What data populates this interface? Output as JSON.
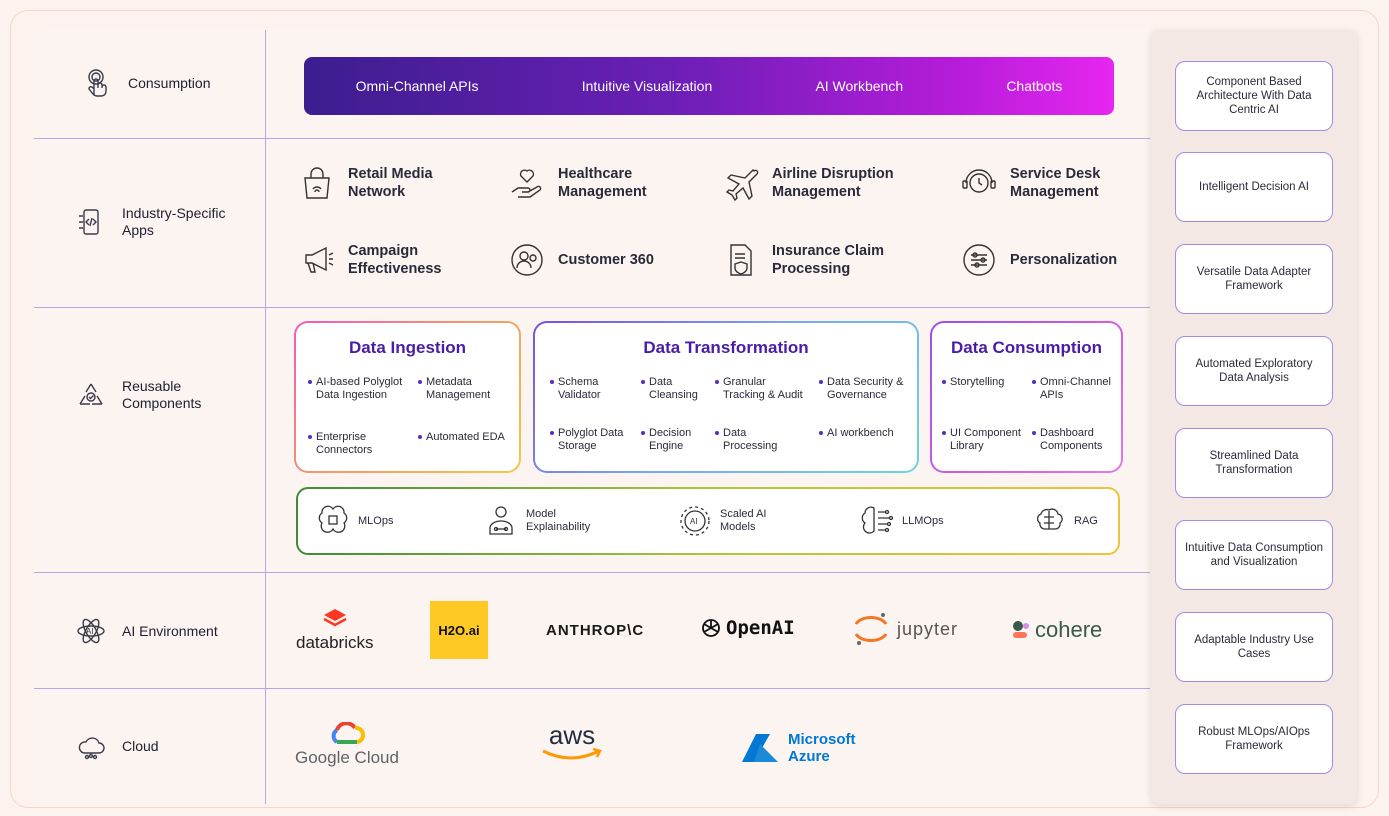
{
  "rows": {
    "consumption": "Consumption",
    "industry": "Industry-Specific Apps",
    "reusable": "Reusable Components",
    "ai_env": "AI Environment",
    "cloud": "Cloud"
  },
  "consumption_items": [
    "Omni-Channel APIs",
    "Intuitive Visualization",
    "AI Workbench",
    "Chatbots"
  ],
  "apps": [
    {
      "label": "Retail Media Network",
      "icon": "retail-bag-icon"
    },
    {
      "label": "Healthcare Management",
      "icon": "heart-hand-icon"
    },
    {
      "label": "Airline Disruption Management",
      "icon": "airplane-icon"
    },
    {
      "label": "Service Desk Management",
      "icon": "headset-clock-icon"
    },
    {
      "label": "Campaign Effectiveness",
      "icon": "megaphone-icon"
    },
    {
      "label": "Customer 360",
      "icon": "customer-icon"
    },
    {
      "label": "Insurance Claim Processing",
      "icon": "document-shield-icon"
    },
    {
      "label": "Personalization",
      "icon": "sliders-icon"
    }
  ],
  "ingestion": {
    "title": "Data Ingestion",
    "items": [
      "AI-based Polyglot Data Ingestion",
      "Metadata Management",
      "Enterprise Connectors",
      "Automated EDA"
    ]
  },
  "transformation": {
    "title": "Data Transformation",
    "items": [
      "Schema Validator",
      "Data Cleansing",
      "Granular Tracking & Audit",
      "Data Security & Governance",
      "Polyglot Data Storage",
      "Decision Engine",
      "Data Processing",
      "AI workbench"
    ]
  },
  "consumption_box": {
    "title": "Data Consumption",
    "items": [
      "Storytelling",
      "Omni-Channel APIs",
      "UI Component Library",
      "Dashboard Components"
    ]
  },
  "ops": [
    "MLOps",
    "Model Explainability",
    "Scaled AI Models",
    "LLMOps",
    "RAG"
  ],
  "ai_logos": [
    "databricks",
    "H2O.ai",
    "ANTHROP\\C",
    "OpenAI",
    "jupyter",
    "cohere"
  ],
  "cloud_logos": [
    "Google Cloud",
    "aws",
    "Microsoft Azure"
  ],
  "side": [
    "Component Based Architecture With Data Centric AI",
    "Intelligent Decision AI",
    "Versatile Data Adapter Framework",
    "Automated Exploratory Data Analysis",
    "Streamlined Data Transformation",
    "Intuitive Data Consumption and Visualization",
    "Adaptable Industry Use Cases",
    "Robust MLOps/AIOps Framework"
  ],
  "colors": {
    "accent": "#4a1da6",
    "divider": "#b9a4e6",
    "bar_start": "#3c1e8f",
    "bar_end": "#e626f0"
  }
}
